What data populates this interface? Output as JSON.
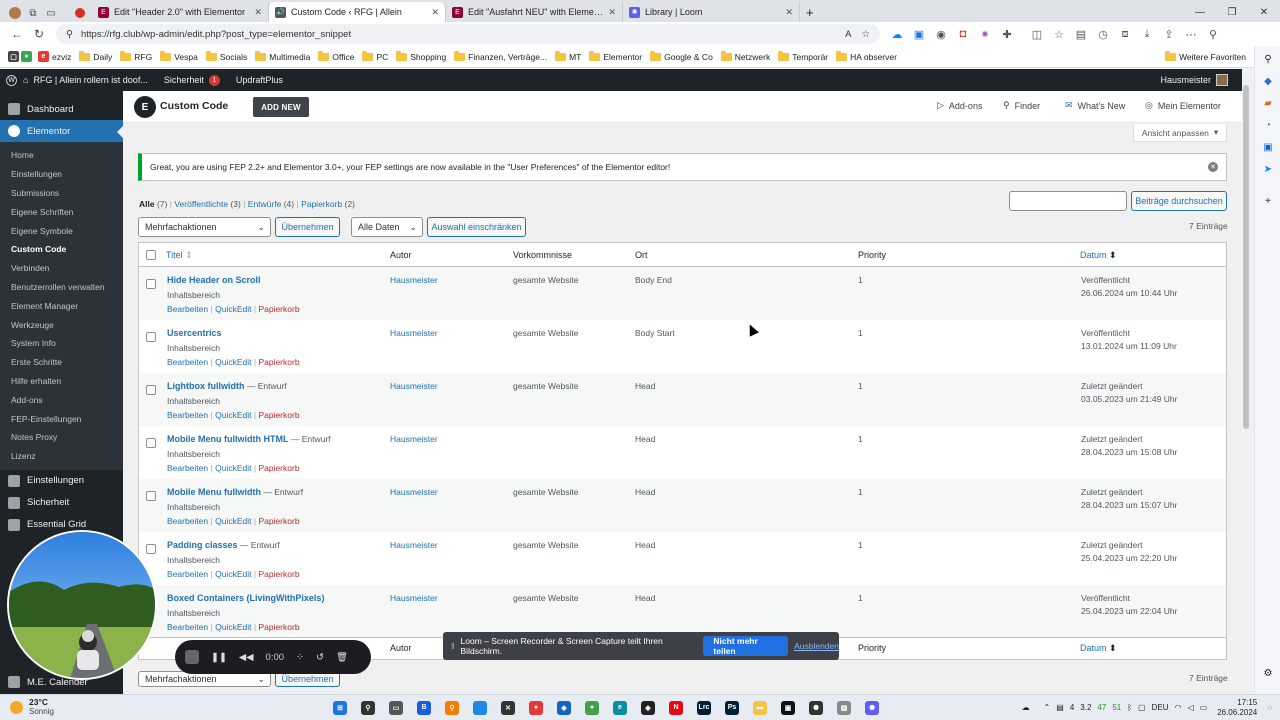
{
  "browser": {
    "tabs": [
      {
        "title": "Edit \"Header 2.0\" with Elementor",
        "color": "#92003b",
        "glyph": "E"
      },
      {
        "title": "Custom Code ‹ RFG | Allein",
        "color": "#555",
        "glyph": "🔊",
        "active": true
      },
      {
        "title": "Edit \"Ausfahrt NEU\" with Elementor",
        "color": "#92003b",
        "glyph": "E"
      },
      {
        "title": "Library | Loom",
        "color": "#625df5",
        "glyph": "✺"
      }
    ],
    "url": "https://rfg.club/wp-admin/edit.php?post_type=elementor_snippet",
    "bookmarks": [
      "ezviz",
      "Daily",
      "RFG",
      "Vespa",
      "Socials",
      "Multimedia",
      "Office",
      "PC",
      "Shopping",
      "Finanzen, Verträge...",
      "MT",
      "Elementor",
      "Google & Co",
      "Netzwerk",
      "Temporär",
      "HA observer"
    ],
    "more_bookmarks": "Weitere Favoriten"
  },
  "adminbar": {
    "site": "RFG | Allein rollern ist doof...",
    "security": "Sicherheit",
    "security_count": "1",
    "updraft": "UpdraftPlus",
    "user": "Hausmeister"
  },
  "menu": {
    "dashboard": "Dashboard",
    "elementor": "Elementor",
    "submenu": [
      "Home",
      "Einstellungen",
      "Submissions",
      "Eigene Schriften",
      "Eigene Symbole",
      "Custom Code",
      "Verbinden",
      "Benutzerrollen verwalten",
      "Element Manager",
      "Werkzeuge",
      "System Info",
      "Erste Schritte",
      "Hilfe erhalten",
      "Add-ons",
      "FEP-Einstellungen",
      "Notes Proxy",
      "Lizenz"
    ],
    "current_sub": "Custom Code",
    "after": [
      "Einstellungen",
      "Sicherheit",
      "Essential Grid"
    ],
    "bottom": "M.E. Calender"
  },
  "header": {
    "title": "Custom Code",
    "add_new": "ADD NEW",
    "addons": "Add-ons",
    "finder": "Finder",
    "whats_new": "What's New",
    "my_elementor": "Mein Elementor"
  },
  "screen_options": "Ansicht anpassen",
  "notice": "Great, you are using FEP 2.2+ and Elementor 3.0+, your FEP settings are now available in the \"User Preferences\" of the Elementor editor!",
  "views": {
    "all": "Alle",
    "all_count": "(7)",
    "published": "Veröffentlichte",
    "published_count": "(3)",
    "drafts": "Entwürfe",
    "drafts_count": "(4)",
    "trash": "Papierkorb",
    "trash_count": "(2)"
  },
  "filters": {
    "bulk": "Mehrfachaktionen",
    "apply": "Übernehmen",
    "dates": "Alle Daten",
    "filter": "Auswahl einschränken",
    "search_button": "Beiträge durchsuchen",
    "count": "7 Einträge"
  },
  "columns": {
    "title": "Titel",
    "author": "Autor",
    "occurrences": "Vorkommnisse",
    "location": "Ort",
    "priority": "Priority",
    "date": "Datum"
  },
  "row_actions": {
    "edit": "Bearbeiten",
    "quickedit": "QuickEdit",
    "trash": "Papierkorb"
  },
  "rows": [
    {
      "title": "Hide Header on Scroll",
      "state": "",
      "type": "Inhaltsbereich",
      "author": "Hausmeister",
      "occ": "gesamte Website",
      "loc": "Body End",
      "prio": "1",
      "status": "Veröffentlicht",
      "date": "26.06.2024 um 10:44 Uhr"
    },
    {
      "title": "Usercentrics",
      "state": "",
      "type": "Inhaltsbereich",
      "author": "Hausmeister",
      "occ": "gesamte Website",
      "loc": "Body Start",
      "prio": "1",
      "status": "Veröffentlicht",
      "date": "13.01.2024 um 11:09 Uhr"
    },
    {
      "title": "Lightbox fullwidth",
      "state": "— Entwurf",
      "type": "Inhaltsbereich",
      "author": "Hausmeister",
      "occ": "gesamte Website",
      "loc": "Head",
      "prio": "1",
      "status": "Zuletzt geändert",
      "date": "03.05.2023 um 21:49 Uhr"
    },
    {
      "title": "Mobile Menu fullwidth HTML",
      "state": "— Entwurf",
      "type": "Inhaltsbereich",
      "author": "Hausmeister",
      "occ": "",
      "loc": "Head",
      "prio": "1",
      "status": "Zuletzt geändert",
      "date": "28.04.2023 um 15:08 Uhr"
    },
    {
      "title": "Mobile Menu fullwidth",
      "state": "— Entwurf",
      "type": "Inhaltsbereich",
      "author": "Hausmeister",
      "occ": "gesamte Website",
      "loc": "Head",
      "prio": "1",
      "status": "Zuletzt geändert",
      "date": "28.04.2023 um 15:07 Uhr"
    },
    {
      "title": "Padding classes",
      "state": "— Entwurf",
      "type": "Inhaltsbereich",
      "author": "Hausmeister",
      "occ": "gesamte Website",
      "loc": "Head",
      "prio": "1",
      "status": "Zuletzt geändert",
      "date": "25.04.2023 um 22:20 Uhr"
    },
    {
      "title": "Boxed Containers (LivingWithPixels)",
      "state": "",
      "type": "Inhaltsbereich",
      "author": "Hausmeister",
      "occ": "gesamte Website",
      "loc": "Head",
      "prio": "1",
      "status": "Veröffentlicht",
      "date": "25.04.2023 um 22:04 Uhr"
    }
  ],
  "loom": {
    "message": "Loom – Screen Recorder & Screen Capture teilt Ihren Bildschirm.",
    "stop": "Nicht mehr teilen",
    "hide": "Ausblenden"
  },
  "recorder": {
    "time": "0:00"
  },
  "taskbar": {
    "weather_temp": "23°C",
    "weather_text": "Sonnig",
    "tray_nums": [
      "4",
      "3.2",
      "47",
      "51"
    ],
    "lang": "DEU",
    "time": "17:15",
    "date": "26.06.2024"
  }
}
